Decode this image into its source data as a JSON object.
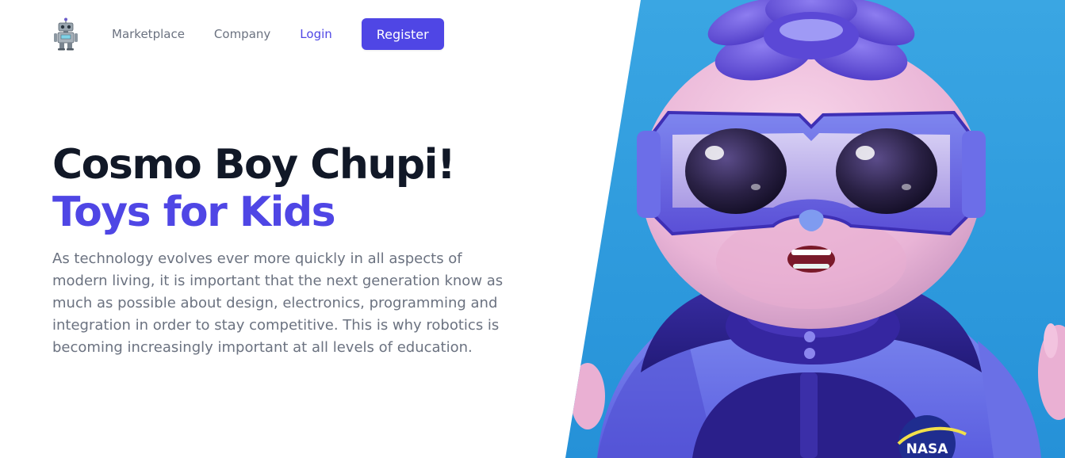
{
  "nav": {
    "logo_name": "robot-logo-icon",
    "links": [
      "Marketplace",
      "Company",
      "Login"
    ],
    "register_label": "Register"
  },
  "hero": {
    "title_line1": "Cosmo Boy Chupi!",
    "title_line2": "Toys for Kids",
    "description": "As technology evolves ever more quickly in all aspects of modern living, it is important that the next generation know as much as possible about design, electronics, programming and integration in order to stay competitive. This is why robotics is becoming increasingly important at all levels of education."
  },
  "illustration": {
    "subject": "cosmo-boy-character",
    "badge_text": "NASA"
  },
  "colors": {
    "accent": "#4f46e5",
    "heading": "#111827",
    "body_text": "#6b7280",
    "art_background": "#2f9fe0"
  }
}
